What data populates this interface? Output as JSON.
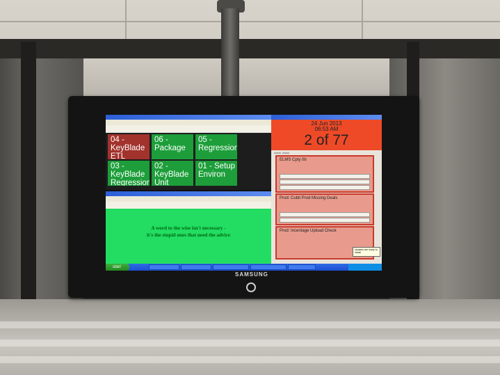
{
  "tv": {
    "brand": "SAMSUNG"
  },
  "tiles": [
    {
      "label": "04 - KeyBlade ETL",
      "status": "failed"
    },
    {
      "label": "06 - Package",
      "status": "passed"
    },
    {
      "label": "05 - Regression",
      "status": "passed"
    },
    {
      "label": "03 - KeyBlade Regression",
      "status": "passed"
    },
    {
      "label": "02 - KeyBlade Unit",
      "status": "passed"
    },
    {
      "label": "01 - Setup Environ",
      "status": "passed"
    }
  ],
  "quote": {
    "line1": "A word to the wise isn't necessary -",
    "line2": "it's the stupid ones that need the advice"
  },
  "monitor": {
    "date": "24 Jun 2013",
    "time": "06:53 AM",
    "count": "2 of 77",
    "cards": [
      {
        "title": "ELMS Cpty 0b"
      },
      {
        "title": "Prod: Cubit Prod Missing Deals"
      },
      {
        "title": "Prod: Incentage Upload Check"
      }
    ]
  },
  "popup": {
    "text": "Updates are ready to install"
  },
  "taskbar": {
    "start_label": "start"
  },
  "colors": {
    "failed": "#a2322c",
    "passed": "#1d9e3a",
    "alert": "#ee4a28",
    "quote_bg": "#22dd61"
  }
}
